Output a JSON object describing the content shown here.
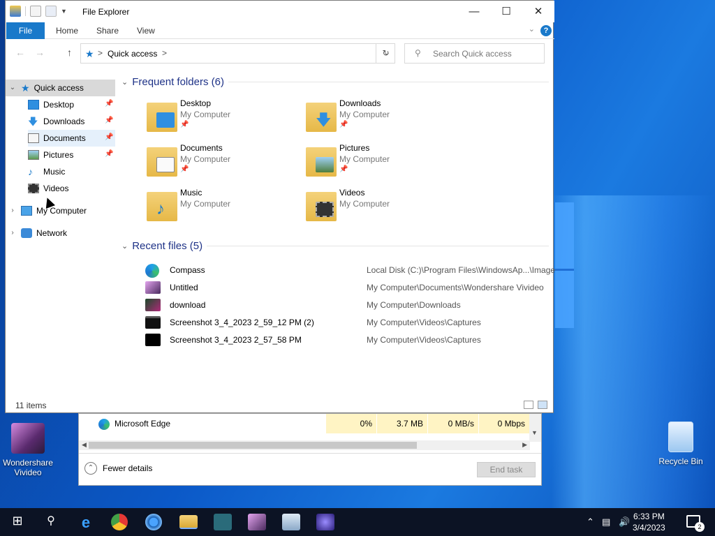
{
  "window": {
    "title": "File Explorer",
    "minimize": "—",
    "maximize": "☐",
    "close": "✕"
  },
  "ribbon": {
    "tabs": [
      "File",
      "Home",
      "Share",
      "View"
    ],
    "help": "?"
  },
  "address": {
    "separator": ">",
    "location": "Quick access",
    "search_placeholder": "Search Quick access"
  },
  "nav": {
    "items": [
      {
        "label": "Quick access",
        "icon": "star-icon",
        "selected": true
      },
      {
        "label": "Desktop",
        "icon": "desktop-icon",
        "pinned": true
      },
      {
        "label": "Downloads",
        "icon": "download-icon",
        "pinned": true
      },
      {
        "label": "Documents",
        "icon": "document-icon",
        "pinned": true
      },
      {
        "label": "Pictures",
        "icon": "picture-icon",
        "pinned": true
      },
      {
        "label": "Music",
        "icon": "music-icon"
      },
      {
        "label": "Videos",
        "icon": "video-icon"
      },
      {
        "label": "My Computer",
        "icon": "computer-icon"
      },
      {
        "label": "Network",
        "icon": "network-icon"
      }
    ]
  },
  "frequent": {
    "header": "Frequent folders (6)",
    "folders": [
      {
        "name": "Desktop",
        "location": "My Computer",
        "icon": "desktop-icon"
      },
      {
        "name": "Downloads",
        "location": "My Computer",
        "icon": "download-icon"
      },
      {
        "name": "Documents",
        "location": "My Computer",
        "icon": "document-icon"
      },
      {
        "name": "Pictures",
        "location": "My Computer",
        "icon": "picture-icon"
      },
      {
        "name": "Music",
        "location": "My Computer",
        "icon": "music-icon"
      },
      {
        "name": "Videos",
        "location": "My Computer",
        "icon": "video-icon"
      }
    ]
  },
  "recent": {
    "header": "Recent files (5)",
    "files": [
      {
        "name": "Compass",
        "path": "Local Disk (C:)\\Program Files\\WindowsAp...\\Images",
        "icon": "edge-icon"
      },
      {
        "name": "Untitled",
        "path": "My Computer\\Documents\\Wondershare Vivideo",
        "icon": "vivideo-icon"
      },
      {
        "name": "download",
        "path": "My Computer\\Downloads",
        "icon": "image-thumb-icon"
      },
      {
        "name": "Screenshot 3_4_2023 2_59_12 PM (2)",
        "path": "My Computer\\Videos\\Captures",
        "icon": "screenshot-thumb-icon"
      },
      {
        "name": "Screenshot 3_4_2023 2_57_58 PM",
        "path": "My Computer\\Videos\\Captures",
        "icon": "screenshot-thumb-icon"
      }
    ]
  },
  "status": {
    "items": "11 items"
  },
  "taskmgr": {
    "process": "Microsoft Edge",
    "cpu": "0%",
    "memory": "3.7 MB",
    "disk": "0 MB/s",
    "network": "0 Mbps",
    "fewer_details": "Fewer details",
    "end_task": "End task"
  },
  "desktop": {
    "icons": [
      {
        "label": "Wondershare Vivideo"
      },
      {
        "label": "Recycle Bin"
      }
    ]
  },
  "taskbar": {
    "time": "6:33 PM",
    "date": "3/4/2023",
    "notifications": "2"
  }
}
